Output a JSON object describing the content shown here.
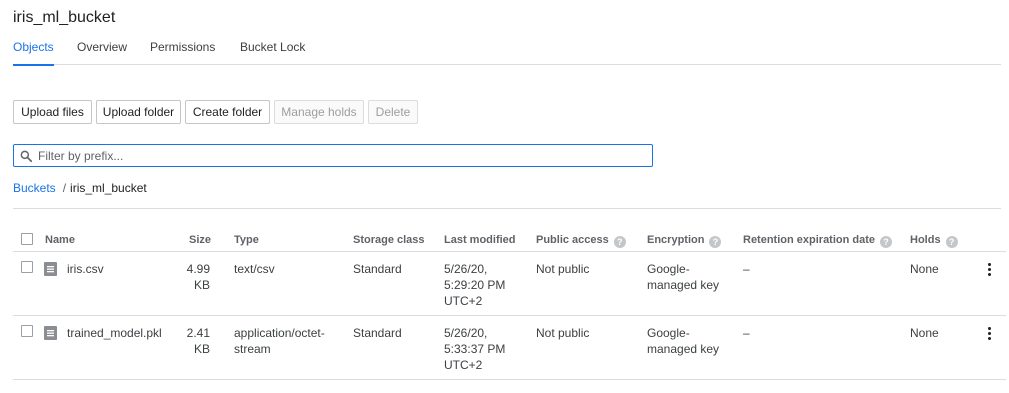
{
  "bucket": {
    "title": "iris_ml_bucket"
  },
  "tabs": [
    {
      "label": "Objects",
      "active": true
    },
    {
      "label": "Overview",
      "active": false
    },
    {
      "label": "Permissions",
      "active": false
    },
    {
      "label": "Bucket Lock",
      "active": false
    }
  ],
  "toolbar": {
    "upload_files": "Upload files",
    "upload_folder": "Upload folder",
    "create_folder": "Create folder",
    "manage_holds": "Manage holds",
    "delete": "Delete"
  },
  "filter": {
    "placeholder": "Filter by prefix..."
  },
  "breadcrumb": {
    "root": "Buckets",
    "separator": "/",
    "current": "iris_ml_bucket"
  },
  "table": {
    "headers": {
      "name": "Name",
      "size": "Size",
      "type": "Type",
      "storage_class": "Storage class",
      "last_modified": "Last modified",
      "public_access": "Public access",
      "encryption": "Encryption",
      "retention": "Retention expiration date",
      "holds": "Holds"
    },
    "help_glyph": "?",
    "rows": [
      {
        "name": "iris.csv",
        "size_value": "4.99",
        "size_unit": "KB",
        "type_line1": "text/csv",
        "type_line2": "",
        "storage_class": "Standard",
        "modified_date": "5/26/20,",
        "modified_time": "5:29:20 PM",
        "modified_tz": "UTC+2",
        "public_access": "Not public",
        "encryption_line1": "Google-",
        "encryption_line2": "managed key",
        "retention": "–",
        "holds": "None"
      },
      {
        "name": "trained_model.pkl",
        "size_value": "2.41",
        "size_unit": "KB",
        "type_line1": "application/octet-",
        "type_line2": "stream",
        "storage_class": "Standard",
        "modified_date": "5/26/20,",
        "modified_time": "5:33:37 PM",
        "modified_tz": "UTC+2",
        "public_access": "Not public",
        "encryption_line1": "Google-",
        "encryption_line2": "managed key",
        "retention": "–",
        "holds": "None"
      }
    ]
  },
  "colors": {
    "accent": "#1a73e8",
    "divider": "#dadce0",
    "text": "#202124",
    "muted": "#5f6368"
  }
}
